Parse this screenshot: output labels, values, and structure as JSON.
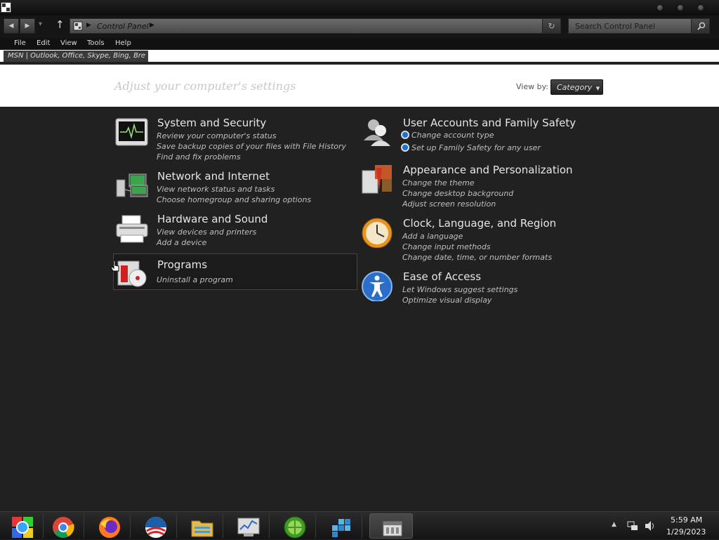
{
  "window": {
    "address_path": "Control Panel",
    "search_placeholder": "Search Control Panel"
  },
  "menu": [
    "File",
    "Edit",
    "View",
    "Tools",
    "Help"
  ],
  "favorites": {
    "item": "MSN | Outlook, Office, Skype, Bing, Bre"
  },
  "header": {
    "title": "Adjust your computer's settings",
    "view_by_label": "View by:",
    "view_by_value": "Category"
  },
  "categories": {
    "system": {
      "title": "System and Security",
      "links": [
        "Review your computer's status",
        "Save backup copies of your files with File History",
        "Find and fix problems"
      ]
    },
    "network": {
      "title": "Network and Internet",
      "links": [
        "View network status and tasks",
        "Choose homegroup and sharing options"
      ]
    },
    "hardware": {
      "title": "Hardware and Sound",
      "links": [
        "View devices and printers",
        "Add a device"
      ]
    },
    "programs": {
      "title": "Programs",
      "links": [
        "Uninstall a program"
      ]
    },
    "users": {
      "title": "User Accounts and Family Safety",
      "links": [
        "Change account type",
        "Set up Family Safety for any user"
      ]
    },
    "appearance": {
      "title": "Appearance and Personalization",
      "links": [
        "Change the theme",
        "Change desktop background",
        "Adjust screen resolution"
      ]
    },
    "clock": {
      "title": "Clock, Language, and Region",
      "links": [
        "Add a language",
        "Change input methods",
        "Change date, time, or number formats"
      ]
    },
    "ease": {
      "title": "Ease of Access",
      "links": [
        "Let Windows suggest settings",
        "Optimize visual display"
      ]
    }
  },
  "taskbar": {
    "apps": [
      "start-orb",
      "chrome",
      "firefox",
      "obama-logo",
      "file-explorer",
      "task-manager",
      "green-app",
      "blue-cubes-app",
      "control-panel"
    ],
    "time": "5:59 AM",
    "date": "1/29/2023"
  },
  "colors": {
    "background": "#212121",
    "header_bg": "#ffffff",
    "text": "#e6e6e6"
  }
}
